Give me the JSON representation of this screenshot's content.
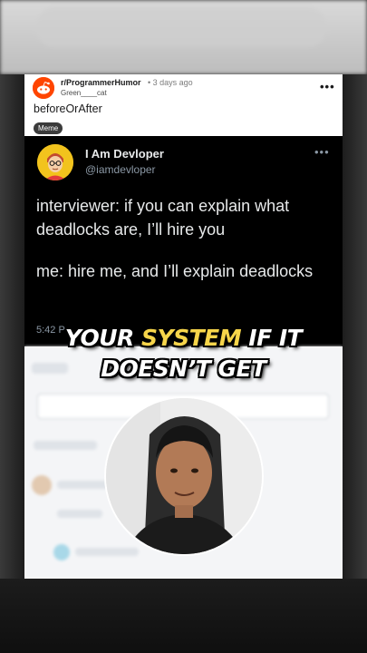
{
  "post": {
    "subreddit": "r/ProgrammerHumor",
    "time": "• 3 days ago",
    "username": "Green____cat",
    "more": "•••",
    "title": "beforeOrAfter",
    "flair": "Meme"
  },
  "tweet": {
    "name": "I Am Devloper",
    "handle": "@iamdevloper",
    "more": "•••",
    "line1": "interviewer: if you can explain what deadlocks are, I’ll hire you",
    "line2": "me: hire me, and I’ll explain deadlocks",
    "time": "5:42 P"
  },
  "caption": {
    "line1_a": "YOUR ",
    "line1_highlight": "SYSTEM",
    "line1_b": " IF IT",
    "line2": "DOESN’T GET"
  },
  "colors": {
    "highlight": "#f7d54a",
    "reddit_orange": "#ff4500",
    "tweet_bg": "#000000"
  },
  "icons": {
    "subreddit_avatar": "reddit-alien-icon",
    "tweet_avatar": "cartoon-developer-avatar",
    "webcam": "presenter-webcam-bubble"
  }
}
